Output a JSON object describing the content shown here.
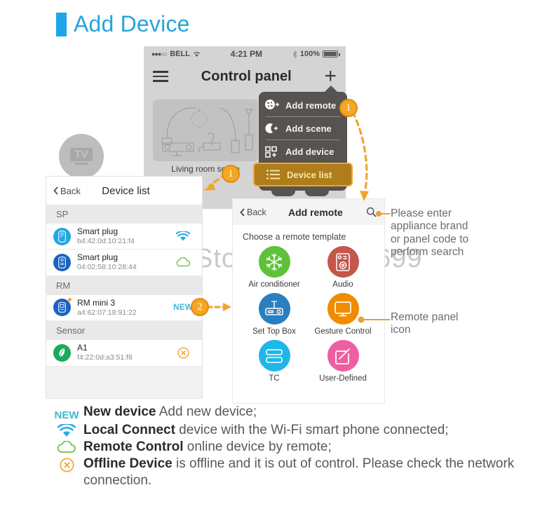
{
  "page": {
    "title": "Add Device",
    "accent": "#27a3dd",
    "watermark": "Store No.1232699"
  },
  "phone": {
    "statusbar": {
      "signal_dots": "●●●○○",
      "carrier": "BELL",
      "wifi_icon": "wifi-icon",
      "time": "4:21 PM",
      "bluetooth_icon": "bluetooth-icon",
      "battery": "100%"
    },
    "navbar": {
      "menu_icon": "hamburger-icon",
      "title": "Control panel",
      "add_icon": "plus-icon"
    },
    "scene": {
      "label": "Living room scene"
    },
    "tv_tile": {
      "glyph": "TV",
      "label": "TV"
    },
    "dropdown": {
      "items": [
        {
          "label": "Add remote",
          "icon": "remote-plus-icon",
          "highlighted": false
        },
        {
          "label": "Add scene",
          "icon": "moon-plus-icon",
          "highlighted": false
        },
        {
          "label": "Add device",
          "icon": "grid-plus-icon",
          "highlighted": false
        },
        {
          "label": "Device list",
          "icon": "list-icon",
          "highlighted": true
        }
      ],
      "highlight_bg": "#b07d1c",
      "highlight_border": "#f0a52e"
    }
  },
  "device_list": {
    "back_label": "Back",
    "title": "Device list",
    "sections": [
      {
        "header": "SP",
        "rows": [
          {
            "name": "Smart plug",
            "mac": "b4:42:0d:10:21:f4",
            "avatar_color": "#22a7e0",
            "status": "wifi",
            "status_color": "#2aace4",
            "new": false
          },
          {
            "name": "Smart plug",
            "mac": "04:02:58:10:28:44",
            "avatar_color": "#1a63c4",
            "status": "cloud",
            "status_color": "#7ac143",
            "new": false
          }
        ]
      },
      {
        "header": "RM",
        "rows": [
          {
            "name": "RM mini 3",
            "mac": "a4:62:07:18:91:22",
            "avatar_color": "#1a63c4",
            "status": "new",
            "status_label": "NEW",
            "status_color": "#41b8d0",
            "new": true
          }
        ]
      },
      {
        "header": "Sensor",
        "rows": [
          {
            "name": "A1",
            "mac": "f4:22:0d:a3:51:f8",
            "avatar_color": "#1aab5c",
            "status": "offline",
            "status_color": "#f0a52e",
            "new": false
          }
        ]
      }
    ]
  },
  "add_remote": {
    "back_label": "Back",
    "title": "Add remote",
    "search_icon": "search-icon",
    "subtitle": "Choose a remote template",
    "templates": [
      {
        "label": "Air conditioner",
        "icon": "snowflake-icon",
        "color": "#5ec13a"
      },
      {
        "label": "Audio",
        "icon": "audio-icon",
        "color": "#c4564a"
      },
      {
        "label": "Set Top Box",
        "icon": "settopbox-icon",
        "color": "#2a7fc1"
      },
      {
        "label": "Gesture Control",
        "icon": "gesture-screen-icon",
        "color": "#f08c00"
      },
      {
        "label": "TC",
        "icon": "tc-icon",
        "color": "#1fb6e8"
      },
      {
        "label": "User-Defined",
        "icon": "pencil-square-icon",
        "color": "#ef5fa0"
      }
    ]
  },
  "callouts": {
    "badge_1a": "1",
    "badge_1b": "1",
    "badge_2": "2",
    "search_note": "Please enter\nappliance brand\nor panel code to\nperform search",
    "search_note_lines": [
      "Please enter",
      "appliance brand",
      "or panel code to",
      "perform search"
    ],
    "panel_note_lines": [
      "Remote panel",
      "icon"
    ]
  },
  "legend": {
    "items": [
      {
        "icon": "new-label",
        "icon_text": "NEW",
        "icon_color": "#41b8d0",
        "bold": "New device",
        "rest": " Add new device;"
      },
      {
        "icon": "wifi-icon",
        "icon_color": "#2aace4",
        "bold": "Local Connect",
        "rest": " device with the Wi-Fi smart phone connected;"
      },
      {
        "icon": "cloud-icon",
        "icon_color": "#7ac143",
        "bold": "Remote Control",
        "rest": " online device by remote;"
      },
      {
        "icon": "offline-icon",
        "icon_color": "#f0a52e",
        "bold": "Offline Device",
        "rest": " is offline and it is out of control. Please check the network connection."
      }
    ]
  }
}
